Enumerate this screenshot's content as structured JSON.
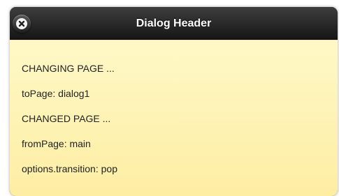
{
  "dialog": {
    "title": "Dialog Header",
    "close_icon": "close-icon"
  },
  "log": [
    "CHANGING PAGE ...",
    "toPage: dialog1",
    "CHANGED PAGE ...",
    "fromPage: main",
    "options.transition: pop"
  ],
  "colors": {
    "header": "#161616",
    "content_top": "#fff8c7",
    "content_bottom": "#fdeea3"
  }
}
